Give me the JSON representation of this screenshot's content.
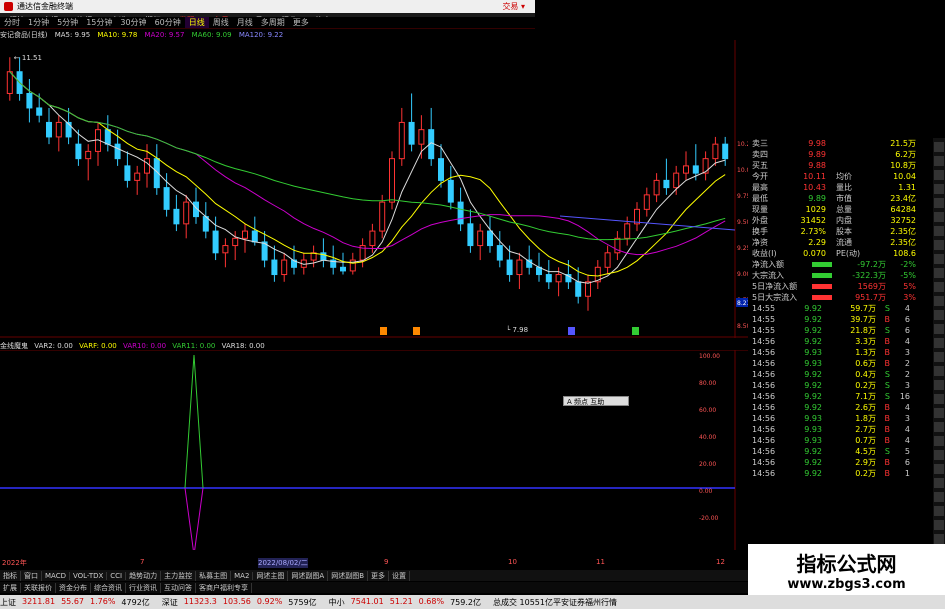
{
  "window": {
    "title": "通达信金融终端",
    "right_label": "交易 ▾"
  },
  "menu": [
    "行情",
    "市场",
    "资讯",
    "自选",
    "期权",
    "发现",
    "交易",
    "工具",
    "行业",
    "热点",
    "L1L2"
  ],
  "periods": [
    "分时",
    "1分钟",
    "5分钟",
    "15分钟",
    "30分钟",
    "60分钟",
    "日线",
    "周线",
    "月线",
    "多周期",
    "更多"
  ],
  "active_period": "日线",
  "ma_line": {
    "stock": "安记食品(日线)",
    "ma5": "MA5: 9.95",
    "ma10": "MA10: 9.78",
    "ma20": "MA20: 9.57",
    "ma60": "MA60: 9.09",
    "ma120": "MA120: 9.22"
  },
  "price_labels": {
    "high": "11.51",
    "low": "7.98"
  },
  "right_axis": [
    "10.25",
    "10.00",
    "9.75",
    "9.50",
    "9.25",
    "9.00",
    "8.75",
    "8.50"
  ],
  "cur_price_tag": "8.21",
  "sub_indicator": {
    "name": "金线魔鬼",
    "vars": [
      "VAR2: 0.00",
      "VARF: 0.00",
      "VAR10: 0.00",
      "VAR11: 0.00",
      "VAR18: 0.00"
    ]
  },
  "sub_axis": [
    "100.00",
    "80.00",
    "60.00",
    "40.00",
    "20.00",
    "0.00",
    "-20.00"
  ],
  "date_axis": [
    "2022年",
    "7",
    "2022/08/02/二",
    "9",
    "10",
    "11",
    "12"
  ],
  "floating_tip": "A 频点 互助",
  "quote": {
    "book": [
      {
        "k": "卖三",
        "v": "9.98",
        "n": "21.5万"
      },
      {
        "k": "卖四",
        "v": "9.89",
        "n": "6.2万"
      },
      {
        "k": "买五",
        "v": "9.88",
        "n": "10.8万"
      }
    ],
    "stats": [
      {
        "k": "今开",
        "v": "10.11",
        "k2": "均价",
        "v2": "10.04"
      },
      {
        "k": "最高",
        "v": "10.43",
        "k2": "量比",
        "v2": "1.31"
      },
      {
        "k": "最低",
        "v": "9.89",
        "k2": "市值",
        "v2": "23.4亿"
      },
      {
        "k": "现量",
        "v": "1029",
        "k2": "总量",
        "v2": "64284"
      },
      {
        "k": "外盘",
        "v": "31452",
        "k2": "内盘",
        "v2": "32752"
      },
      {
        "k": "换手",
        "v": "2.73%",
        "k2": "股本",
        "v2": "2.35亿"
      },
      {
        "k": "净资",
        "v": "2.29",
        "k2": "流通",
        "v2": "2.35亿"
      },
      {
        "k": "收益(I)",
        "v": "0.070",
        "k2": "PE(动)",
        "v2": "108.6"
      }
    ],
    "flows": [
      {
        "k": "净流入额",
        "v": "-97.2万",
        "pct": "-2%",
        "color": "#3c3"
      },
      {
        "k": "大宗流入",
        "v": "-322.3万",
        "pct": "-5%",
        "color": "#3c3"
      },
      {
        "k": "5日净流入额",
        "v": "1569万",
        "pct": "5%",
        "color": "#f33"
      },
      {
        "k": "5日大宗流入",
        "v": "951.7万",
        "pct": "3%",
        "color": "#f33"
      }
    ],
    "ticks": [
      {
        "t": "14:55",
        "p": "9.92",
        "v": "59.7万",
        "d": "S",
        "n": "4"
      },
      {
        "t": "14:55",
        "p": "9.92",
        "v": "39.7万",
        "d": "B",
        "n": "6"
      },
      {
        "t": "14:55",
        "p": "9.92",
        "v": "21.8万",
        "d": "S",
        "n": "6"
      },
      {
        "t": "14:56",
        "p": "9.92",
        "v": "3.3万",
        "d": "B",
        "n": "4"
      },
      {
        "t": "14:56",
        "p": "9.93",
        "v": "1.3万",
        "d": "B",
        "n": "3"
      },
      {
        "t": "14:56",
        "p": "9.93",
        "v": "0.6万",
        "d": "B",
        "n": "2"
      },
      {
        "t": "14:56",
        "p": "9.92",
        "v": "0.4万",
        "d": "S",
        "n": "2"
      },
      {
        "t": "14:56",
        "p": "9.92",
        "v": "0.2万",
        "d": "S",
        "n": "3"
      },
      {
        "t": "14:56",
        "p": "9.92",
        "v": "7.1万",
        "d": "S",
        "n": "16"
      },
      {
        "t": "14:56",
        "p": "9.92",
        "v": "2.6万",
        "d": "B",
        "n": "4"
      },
      {
        "t": "14:56",
        "p": "9.93",
        "v": "1.8万",
        "d": "B",
        "n": "3"
      },
      {
        "t": "14:56",
        "p": "9.93",
        "v": "2.7万",
        "d": "B",
        "n": "4"
      },
      {
        "t": "14:56",
        "p": "9.93",
        "v": "0.7万",
        "d": "B",
        "n": "4"
      },
      {
        "t": "14:56",
        "p": "9.92",
        "v": "4.5万",
        "d": "S",
        "n": "5"
      },
      {
        "t": "14:56",
        "p": "9.92",
        "v": "2.9万",
        "d": "B",
        "n": "6"
      },
      {
        "t": "14:56",
        "p": "9.92",
        "v": "0.2万",
        "d": "B",
        "n": "1"
      }
    ]
  },
  "bottom_tabs": [
    "指标",
    "窗口",
    "MACD",
    "VOL-TDX",
    "CCI",
    "趋势动力",
    "主力监控",
    "私募主图",
    "MA2",
    "网述主图",
    "网述副图A",
    "网述副图B",
    "更多",
    "设置"
  ],
  "bottom_tabs2": [
    "扩展",
    "关联报价",
    "资金分布",
    "综合资讯",
    "行业资讯",
    "互动问答",
    "客商户福利专享"
  ],
  "status": [
    {
      "lbl": "上证",
      "val": "3211.81",
      "chg": "55.67",
      "pct": "1.76%",
      "vol": "4792亿"
    },
    {
      "lbl": "深证",
      "val": "11323.3",
      "chg": "103.56",
      "pct": "0.92%",
      "vol": "5759亿"
    },
    {
      "lbl": "中小",
      "val": "7541.01",
      "chg": "51.21",
      "pct": "0.68%",
      "vol": "759.2亿"
    }
  ],
  "status_extra": "总成交 10551亿平安证券福州行情",
  "ad": {
    "big": "指标公式网",
    "url": "www.zbgs3.com"
  },
  "chart_data": {
    "type": "candlestick",
    "ylim": [
      7.9,
      11.6
    ],
    "candles": [
      [
        11.0,
        11.5,
        10.9,
        11.3
      ],
      [
        11.3,
        11.5,
        10.9,
        11.0
      ],
      [
        11.0,
        11.2,
        10.6,
        10.8
      ],
      [
        10.8,
        11.0,
        10.6,
        10.7
      ],
      [
        10.6,
        10.8,
        10.3,
        10.4
      ],
      [
        10.4,
        10.7,
        10.2,
        10.6
      ],
      [
        10.6,
        10.8,
        10.3,
        10.4
      ],
      [
        10.3,
        10.5,
        10.0,
        10.1
      ],
      [
        10.1,
        10.3,
        9.8,
        10.2
      ],
      [
        10.2,
        10.6,
        10.0,
        10.5
      ],
      [
        10.5,
        10.7,
        10.2,
        10.3
      ],
      [
        10.3,
        10.5,
        10.0,
        10.1
      ],
      [
        10.0,
        10.2,
        9.7,
        9.8
      ],
      [
        9.8,
        10.0,
        9.6,
        9.9
      ],
      [
        9.9,
        10.3,
        9.7,
        10.1
      ],
      [
        10.1,
        10.3,
        9.6,
        9.7
      ],
      [
        9.7,
        9.9,
        9.3,
        9.4
      ],
      [
        9.4,
        9.6,
        9.1,
        9.2
      ],
      [
        9.2,
        9.6,
        9.0,
        9.5
      ],
      [
        9.5,
        9.7,
        9.2,
        9.3
      ],
      [
        9.3,
        9.5,
        9.0,
        9.1
      ],
      [
        9.1,
        9.3,
        8.7,
        8.8
      ],
      [
        8.8,
        9.0,
        8.6,
        8.9
      ],
      [
        8.9,
        9.1,
        8.7,
        9.0
      ],
      [
        9.0,
        9.2,
        8.8,
        9.1
      ],
      [
        9.1,
        9.3,
        8.9,
        8.95
      ],
      [
        8.95,
        9.1,
        8.6,
        8.7
      ],
      [
        8.7,
        8.9,
        8.4,
        8.5
      ],
      [
        8.5,
        8.8,
        8.4,
        8.7
      ],
      [
        8.7,
        8.9,
        8.5,
        8.6
      ],
      [
        8.6,
        8.8,
        8.5,
        8.7
      ],
      [
        8.7,
        8.9,
        8.6,
        8.8
      ],
      [
        8.8,
        9.0,
        8.6,
        8.7
      ],
      [
        8.7,
        8.9,
        8.5,
        8.6
      ],
      [
        8.6,
        8.8,
        8.5,
        8.55
      ],
      [
        8.55,
        8.8,
        8.5,
        8.7
      ],
      [
        8.7,
        9.0,
        8.6,
        8.9
      ],
      [
        8.9,
        9.2,
        8.8,
        9.1
      ],
      [
        9.1,
        9.6,
        9.0,
        9.5
      ],
      [
        9.5,
        10.2,
        9.4,
        10.1
      ],
      [
        10.1,
        10.8,
        10.0,
        10.6
      ],
      [
        10.6,
        11.0,
        10.2,
        10.3
      ],
      [
        10.3,
        10.7,
        10.1,
        10.5
      ],
      [
        10.5,
        10.8,
        10.0,
        10.1
      ],
      [
        10.1,
        10.3,
        9.7,
        9.8
      ],
      [
        9.8,
        10.0,
        9.4,
        9.5
      ],
      [
        9.5,
        9.7,
        9.1,
        9.2
      ],
      [
        9.2,
        9.4,
        8.8,
        8.9
      ],
      [
        8.9,
        9.2,
        8.7,
        9.1
      ],
      [
        9.1,
        9.3,
        8.8,
        8.9
      ],
      [
        8.9,
        9.1,
        8.6,
        8.7
      ],
      [
        8.7,
        8.9,
        8.4,
        8.5
      ],
      [
        8.5,
        8.8,
        8.3,
        8.7
      ],
      [
        8.7,
        8.9,
        8.5,
        8.6
      ],
      [
        8.6,
        8.8,
        8.4,
        8.5
      ],
      [
        8.5,
        8.7,
        8.3,
        8.4
      ],
      [
        8.4,
        8.6,
        8.2,
        8.5
      ],
      [
        8.5,
        8.7,
        8.3,
        8.4
      ],
      [
        8.4,
        8.6,
        8.1,
        8.2
      ],
      [
        8.2,
        8.5,
        8.0,
        8.4
      ],
      [
        8.4,
        8.7,
        8.3,
        8.6
      ],
      [
        8.6,
        8.9,
        8.5,
        8.8
      ],
      [
        8.8,
        9.1,
        8.7,
        9.0
      ],
      [
        9.0,
        9.3,
        8.9,
        9.2
      ],
      [
        9.2,
        9.5,
        9.1,
        9.4
      ],
      [
        9.4,
        9.7,
        9.3,
        9.6
      ],
      [
        9.6,
        9.9,
        9.5,
        9.8
      ],
      [
        9.8,
        10.1,
        9.6,
        9.7
      ],
      [
        9.7,
        10.0,
        9.6,
        9.9
      ],
      [
        9.9,
        10.2,
        9.8,
        10.0
      ],
      [
        10.0,
        10.3,
        9.8,
        9.9
      ],
      [
        9.9,
        10.2,
        9.8,
        10.1
      ],
      [
        10.1,
        10.4,
        10.0,
        10.3
      ],
      [
        10.3,
        10.4,
        10.0,
        10.1
      ]
    ]
  }
}
